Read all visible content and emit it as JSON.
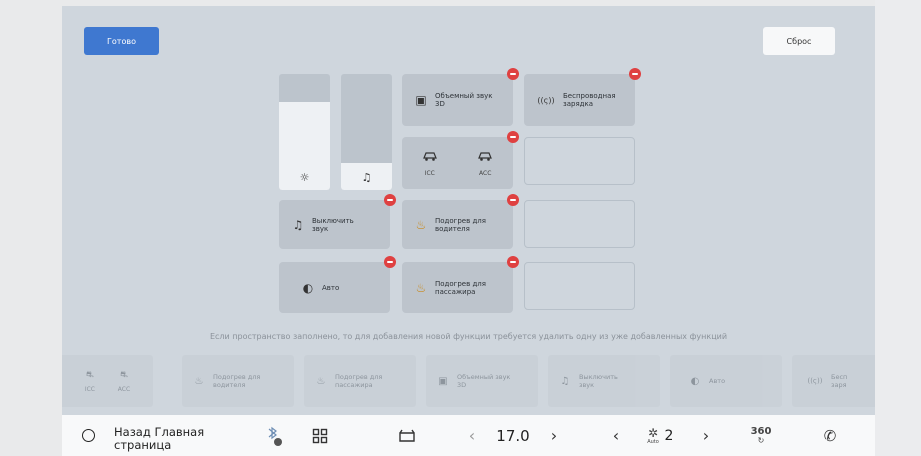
{
  "top": {
    "done_label": "Готово",
    "reset_label": "Сброс"
  },
  "sliders": {
    "brightness_icon": "☼",
    "volume_icon": "♫"
  },
  "tiles": {
    "surround": {
      "icon": "▣",
      "label": "Объемный звук\n3D"
    },
    "wireless": {
      "icon": "((ς))",
      "label": "Беспроводная\nзарядка"
    },
    "icc_label": "ICC",
    "acc_label": "ACC",
    "mute": {
      "icon": "♫",
      "label": "Выключить\nзвук"
    },
    "driver_heat": {
      "icon": "♨",
      "label": "Подогрев для\nводителя"
    },
    "auto": {
      "icon": "◐",
      "label": "Авто"
    },
    "passenger_heat": {
      "icon": "♨",
      "label": "Подогрев для\nпассажира"
    }
  },
  "hint": "Если пространство заполнено, то для добавления новой функции требуется удалить одну из уже добавленных функций",
  "tray": {
    "icc": "ICC",
    "acc": "ACC",
    "driver_heat": "Подогрев для\nводителя",
    "passenger_heat": "Подогрев для\nпассажира",
    "surround": "Объемный звук\n3D",
    "mute": "Выключить\nзвук",
    "auto": "Авто",
    "wireless_partial": "Бесп\nзаря"
  },
  "bottom_bar": {
    "back_label": "Назад Главная\nстраница",
    "temp_value": "17.0",
    "fan_speed": "2",
    "fan_mode": "Auto",
    "view_360": "360"
  }
}
